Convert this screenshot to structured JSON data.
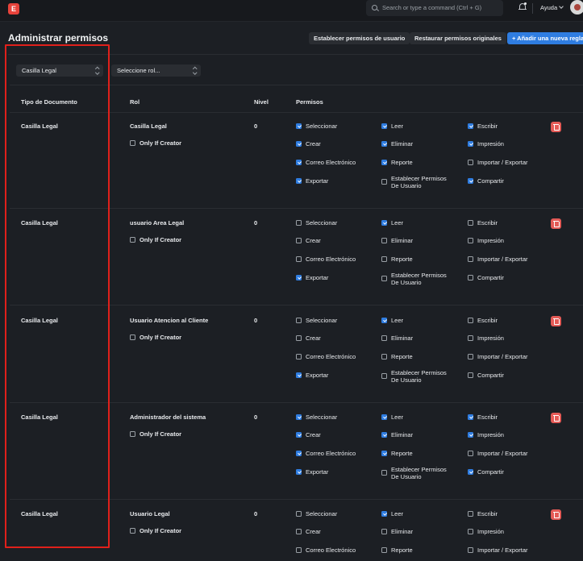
{
  "navbar": {
    "logo": "E",
    "search_placeholder": "Search or type a command (Ctrl + G)",
    "help_label": "Ayuda"
  },
  "header": {
    "title": "Administrar permisos",
    "btn_set_user_permissions": "Establecer permisos de usuario",
    "btn_restore": "Restaurar permisos originales",
    "btn_add_rule": "+ Añadir una nueva regla"
  },
  "filters": {
    "doctype_value": "Casilla Legal",
    "role_value": "Seleccione rol..."
  },
  "columns": {
    "doctype": "Tipo de Documento",
    "role": "Rol",
    "level": "Nivel",
    "permissions": "Permisos"
  },
  "labels": {
    "only_if_creator": "Only If Creator",
    "perm_select": "Seleccionar",
    "perm_read": "Leer",
    "perm_write": "Escribir",
    "perm_create": "Crear",
    "perm_delete": "Eliminar",
    "perm_print": "Impresión",
    "perm_email": "Correo Electrónico",
    "perm_report": "Reporte",
    "perm_import_export": "Importar / Exportar",
    "perm_export": "Exportar",
    "perm_set_user_perms_1": "Establecer Permisos",
    "perm_set_user_perms_2": "De Usuario",
    "perm_share": "Compartir"
  },
  "rows": [
    {
      "doctype": "Casilla Legal",
      "role": "Casilla Legal",
      "level": "0",
      "only_if_creator": false,
      "select": true,
      "read": true,
      "write": true,
      "create": true,
      "delete": true,
      "print": true,
      "email": true,
      "report": true,
      "import_export": false,
      "export": true,
      "set_user_perms": false,
      "share": true
    },
    {
      "doctype": "Casilla Legal",
      "role": "usuario Area Legal",
      "level": "0",
      "only_if_creator": false,
      "select": false,
      "read": true,
      "write": false,
      "create": false,
      "delete": false,
      "print": false,
      "email": false,
      "report": false,
      "import_export": false,
      "export": true,
      "set_user_perms": false,
      "share": false
    },
    {
      "doctype": "Casilla Legal",
      "role": "Usuario Atencion al Cliente",
      "level": "0",
      "only_if_creator": false,
      "select": false,
      "read": true,
      "write": false,
      "create": false,
      "delete": false,
      "print": false,
      "email": false,
      "report": false,
      "import_export": false,
      "export": true,
      "set_user_perms": false,
      "share": false
    },
    {
      "doctype": "Casilla Legal",
      "role": "Administrador del sistema",
      "level": "0",
      "only_if_creator": false,
      "select": true,
      "read": true,
      "write": true,
      "create": true,
      "delete": true,
      "print": true,
      "email": true,
      "report": true,
      "import_export": false,
      "export": true,
      "set_user_perms": false,
      "share": true
    },
    {
      "doctype": "Casilla Legal",
      "role": "Usuario Legal",
      "level": "0",
      "only_if_creator": false,
      "select": false,
      "read": true,
      "write": false,
      "create": false,
      "delete": false,
      "print": false,
      "email": false,
      "report": false,
      "import_export": false,
      "export": false,
      "set_user_perms": false,
      "share": false
    }
  ],
  "colors": {
    "accent": "#2f7de1",
    "danger": "#e45b57",
    "highlight": "#e0201b"
  }
}
